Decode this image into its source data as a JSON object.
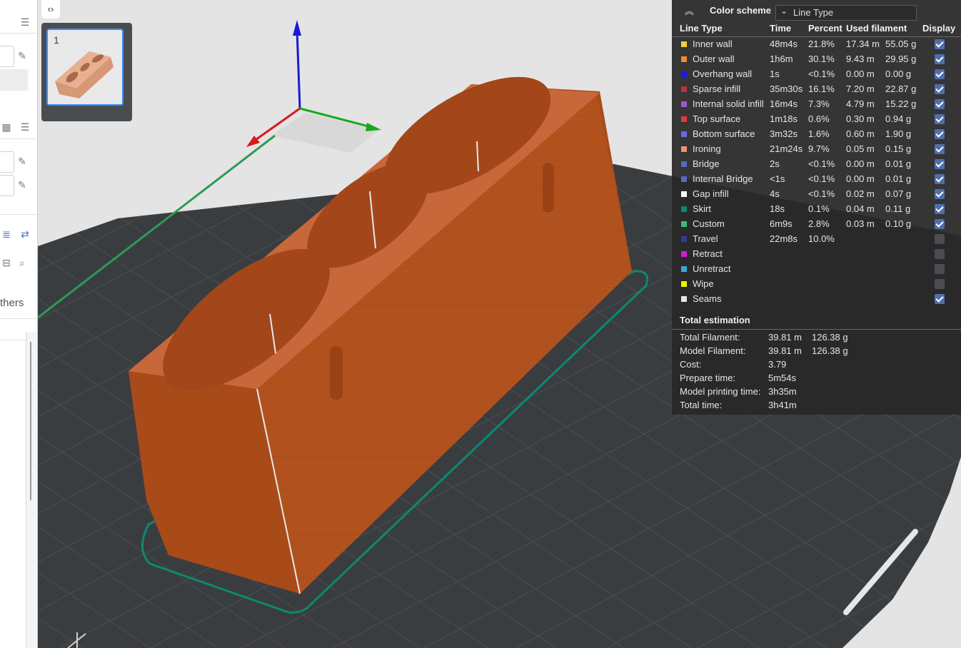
{
  "sidebar": {
    "others_label": "thers"
  },
  "plate": {
    "number": "1"
  },
  "legend": {
    "color_scheme_label": "Color scheme",
    "scheme_value": "Line Type",
    "columns": [
      "Line Type",
      "Time",
      "Percent",
      "Used filament",
      "Display"
    ],
    "rows": [
      {
        "name": "Inner wall",
        "color": "#f2d038",
        "time": "48m4s",
        "percent": "21.8%",
        "length": "17.34 m",
        "weight": "55.05 g",
        "display": true
      },
      {
        "name": "Outer wall",
        "color": "#f08a32",
        "time": "1h6m",
        "percent": "30.1%",
        "length": "9.43 m",
        "weight": "29.95 g",
        "display": true
      },
      {
        "name": "Overhang wall",
        "color": "#1a1ae6",
        "time": "1s",
        "percent": "<0.1%",
        "length": "0.00 m",
        "weight": "0.00 g",
        "display": true
      },
      {
        "name": "Sparse infill",
        "color": "#b03838",
        "time": "35m30s",
        "percent": "16.1%",
        "length": "7.20 m",
        "weight": "22.87 g",
        "display": true
      },
      {
        "name": "Internal solid infill",
        "color": "#9b59d0",
        "time": "16m4s",
        "percent": "7.3%",
        "length": "4.79 m",
        "weight": "15.22 g",
        "display": true
      },
      {
        "name": "Top surface",
        "color": "#e8383a",
        "time": "1m18s",
        "percent": "0.6%",
        "length": "0.30 m",
        "weight": "0.94 g",
        "display": true
      },
      {
        "name": "Bottom surface",
        "color": "#6a6ad8",
        "time": "3m32s",
        "percent": "1.6%",
        "length": "0.60 m",
        "weight": "1.90 g",
        "display": true
      },
      {
        "name": "Ironing",
        "color": "#f09070",
        "time": "21m24s",
        "percent": "9.7%",
        "length": "0.05 m",
        "weight": "0.15 g",
        "display": true
      },
      {
        "name": "Bridge",
        "color": "#4e70b8",
        "time": "2s",
        "percent": "<0.1%",
        "length": "0.00 m",
        "weight": "0.01 g",
        "display": true
      },
      {
        "name": "Internal Bridge",
        "color": "#4e70b8",
        "time": "<1s",
        "percent": "<0.1%",
        "length": "0.00 m",
        "weight": "0.01 g",
        "display": true
      },
      {
        "name": "Gap infill",
        "color": "#ffffff",
        "time": "4s",
        "percent": "<0.1%",
        "length": "0.02 m",
        "weight": "0.07 g",
        "display": true
      },
      {
        "name": "Skirt",
        "color": "#0a8a70",
        "time": "18s",
        "percent": "0.1%",
        "length": "0.04 m",
        "weight": "0.11 g",
        "display": true
      },
      {
        "name": "Custom",
        "color": "#3aba7a",
        "time": "6m9s",
        "percent": "2.8%",
        "length": "0.03 m",
        "weight": "0.10 g",
        "display": true
      },
      {
        "name": "Travel",
        "color": "#38389a",
        "time": "22m8s",
        "percent": "10.0%",
        "length": "",
        "weight": "",
        "display": false
      },
      {
        "name": "Retract",
        "color": "#d81ad8",
        "time": "",
        "percent": "",
        "length": "",
        "weight": "",
        "display": false
      },
      {
        "name": "Unretract",
        "color": "#38a8d8",
        "time": "",
        "percent": "",
        "length": "",
        "weight": "",
        "display": false
      },
      {
        "name": "Wipe",
        "color": "#f0f000",
        "time": "",
        "percent": "",
        "length": "",
        "weight": "",
        "display": false
      },
      {
        "name": "Seams",
        "color": "#e6e6e6",
        "time": "",
        "percent": "",
        "length": "",
        "weight": "",
        "display": true
      }
    ],
    "total_title": "Total estimation",
    "totals": [
      {
        "label": "Total Filament:",
        "value": "39.81 m",
        "value2": "126.38 g"
      },
      {
        "label": "Model Filament:",
        "value": "39.81 m",
        "value2": "126.38 g"
      },
      {
        "label": "Cost:",
        "value": "3.79",
        "value2": ""
      },
      {
        "label": "Prepare time:",
        "value": "5m54s",
        "value2": ""
      },
      {
        "label": "Model printing time:",
        "value": "3h35m",
        "value2": ""
      },
      {
        "label": "Total time:",
        "value": "3h41m",
        "value2": ""
      }
    ]
  },
  "colors": {
    "model": "#b3531f",
    "bed": "#3a3d40",
    "accent": "#3f8cff"
  }
}
